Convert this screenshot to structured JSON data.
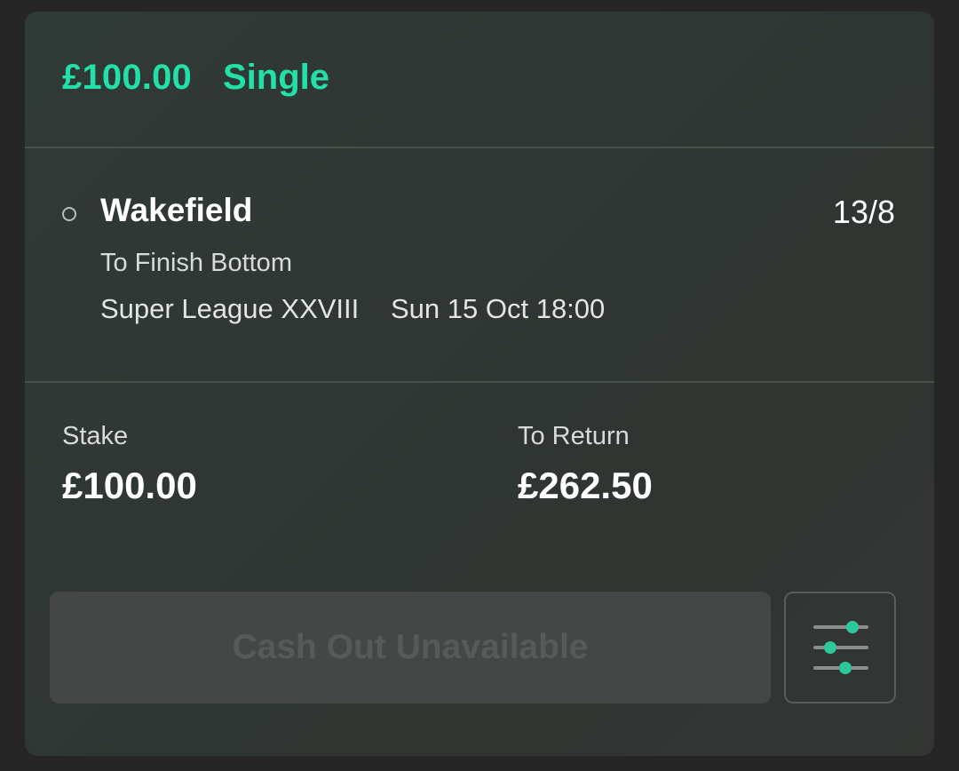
{
  "bet": {
    "stake_amount": "£100.00",
    "bet_type": "Single"
  },
  "selection": {
    "team": "Wakefield",
    "odds": "13/8",
    "market": "To Finish Bottom",
    "event": "Super League XXVIII",
    "event_time": "Sun 15 Oct 18:00"
  },
  "amounts": {
    "stake_label": "Stake",
    "stake_value": "£100.00",
    "return_label": "To Return",
    "return_value": "£262.50"
  },
  "actions": {
    "cashout_label": "Cash Out Unavailable",
    "settings_icon": "sliders-icon"
  },
  "colors": {
    "accent": "#22e0a8",
    "slider_knob": "#2ec79b"
  }
}
